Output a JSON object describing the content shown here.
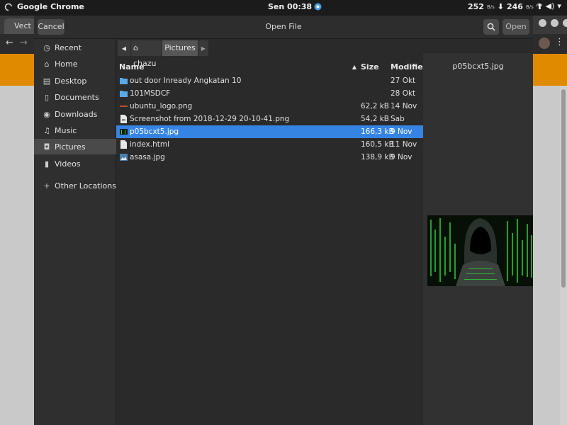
{
  "topbar": {
    "app_name": "Google Chrome",
    "clock": "Sen 00:38",
    "net_down": "252",
    "net_down_unit": "B/s",
    "net_up": "246",
    "net_up_unit": "B/s"
  },
  "chrome": {
    "tab_label": "Vect",
    "accent_color": "#e08a00"
  },
  "dialog": {
    "title": "Open File",
    "cancel_label": "Cancel",
    "open_label": "Open"
  },
  "sidebar": {
    "items": [
      {
        "label": "Recent",
        "icon": "clock-icon"
      },
      {
        "label": "Home",
        "icon": "home-icon"
      },
      {
        "label": "Desktop",
        "icon": "desktop-icon"
      },
      {
        "label": "Documents",
        "icon": "documents-icon"
      },
      {
        "label": "Downloads",
        "icon": "downloads-icon"
      },
      {
        "label": "Music",
        "icon": "music-icon"
      },
      {
        "label": "Pictures",
        "icon": "camera-icon",
        "selected": true
      },
      {
        "label": "Videos",
        "icon": "film-icon"
      }
    ],
    "other_locations_label": "Other Locations"
  },
  "path": {
    "crumbs": [
      "chazu",
      "Pictures"
    ]
  },
  "columns": {
    "name": "Name",
    "size": "Size",
    "modified": "Modified"
  },
  "files": [
    {
      "name": "out door Inready Angkatan 10",
      "size": "",
      "modified": "27 Okt",
      "type": "folder"
    },
    {
      "name": "101MSDCF",
      "size": "",
      "modified": "28 Okt",
      "type": "folder"
    },
    {
      "name": "ubuntu_logo.png",
      "size": "62,2 kB",
      "modified": "14 Nov",
      "type": "image"
    },
    {
      "name": "Screenshot from 2018-12-29 20-10-41.png",
      "size": "54,2 kB",
      "modified": "Sab",
      "type": "document"
    },
    {
      "name": "p05bcxt5.jpg",
      "size": "166,3 kB",
      "modified": "9 Nov",
      "type": "image",
      "selected": true
    },
    {
      "name": "index.html",
      "size": "160,5 kB",
      "modified": "11 Nov",
      "type": "document"
    },
    {
      "name": "asasa.jpg",
      "size": "138,9 kB",
      "modified": "9 Nov",
      "type": "image"
    }
  ],
  "preview": {
    "filename": "p05bcxt5.jpg"
  },
  "colors": {
    "selection": "#3584e4",
    "dialog_bg": "#2a2a2a"
  }
}
